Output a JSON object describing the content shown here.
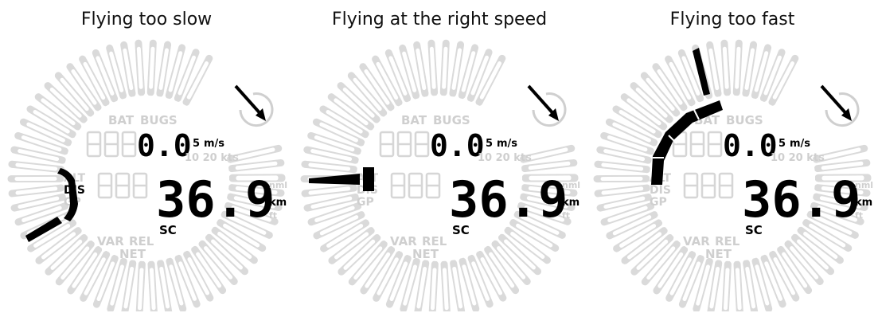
{
  "panels": [
    {
      "title": "Flying too slow",
      "state": "slow",
      "vario_value": "0.0",
      "vario_unit_num": "5",
      "vario_unit": "m/s",
      "scale_labels": "10 20 kts",
      "mode_labels": [
        "BAT",
        "BUGS"
      ],
      "left_labels": [
        "ALT",
        "DIS",
        "GP"
      ],
      "bottom_labels": [
        "VAR",
        "REL",
        "NET"
      ],
      "main_value": "36.9",
      "unit_primary": "km",
      "unit_top": "nml",
      "unit_bottom": "ft",
      "mode_badge": "SC"
    },
    {
      "title": "Flying at the right speed",
      "state": "right",
      "vario_value": "0.0",
      "vario_unit_num": "5",
      "vario_unit": "m/s",
      "scale_labels": "10 20 kts",
      "mode_labels": [
        "BAT",
        "BUGS"
      ],
      "left_labels": [
        "ALT",
        "DIS",
        "GP"
      ],
      "bottom_labels": [
        "VAR",
        "REL",
        "NET"
      ],
      "main_value": "36.9",
      "unit_primary": "km",
      "unit_top": "nml",
      "unit_bottom": "ft",
      "mode_badge": "SC"
    },
    {
      "title": "Flying too fast",
      "state": "fast",
      "vario_value": "0.0",
      "vario_unit_num": "5",
      "vario_unit": "m/s",
      "scale_labels": "10 20 kts",
      "mode_labels": [
        "BAT",
        "BUGS"
      ],
      "left_labels": [
        "ALT",
        "DIS",
        "GP"
      ],
      "bottom_labels": [
        "VAR",
        "REL",
        "NET"
      ],
      "main_value": "36.9",
      "unit_primary": "km",
      "unit_top": "nml",
      "unit_bottom": "ft",
      "mode_badge": "SC"
    }
  ],
  "colors": {
    "active": "#000000",
    "inactive": "#d6d6d6",
    "background": "#ffffff"
  }
}
